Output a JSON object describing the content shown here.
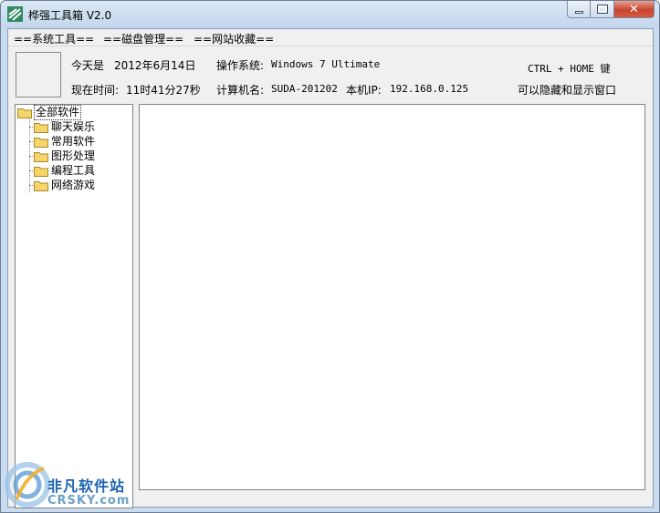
{
  "window": {
    "title": "桦强工具箱 V2.0"
  },
  "menu": [
    "==系统工具==",
    "==磁盘管理==",
    "==网站收藏=="
  ],
  "info": {
    "today_label": "今天是",
    "today_value": "2012年6月14日",
    "time_label": "现在时间:",
    "time_value": "11时41分27秒",
    "os_label": "操作系统:",
    "os_value": "Windows 7 Ultimate",
    "computer_label": "计算机名:",
    "computer_value": "SUDA-201202",
    "ip_label": "本机IP:",
    "ip_value": "192.168.0.125",
    "hotkey": "CTRL + HOME 键",
    "hotkey_hint": "可以隐藏和显示窗口"
  },
  "tree": {
    "root": "全部软件",
    "children": [
      "聊天娱乐",
      "常用软件",
      "图形处理",
      "编程工具",
      "网络游戏"
    ]
  },
  "watermark": {
    "cn": "非凡软件站",
    "en": "CRSKY.com"
  },
  "colors": {
    "close_button": "#c7432e",
    "folder": "#f5d46a",
    "watermark": "#1c64b0"
  }
}
